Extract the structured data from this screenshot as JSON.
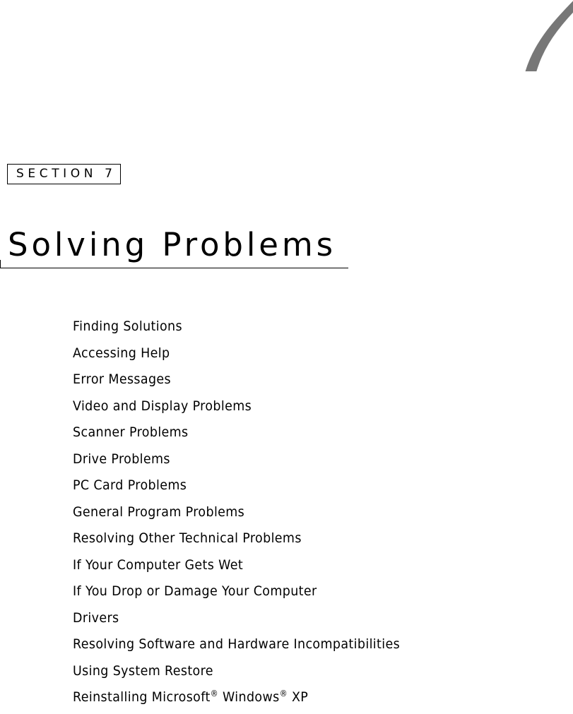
{
  "chapter": {
    "number": "7",
    "number_color": "#777777"
  },
  "section": {
    "label": "SECTION 7"
  },
  "page_title": "Solving Problems",
  "toc": {
    "items": [
      {
        "label": "Finding Solutions"
      },
      {
        "label": "Accessing Help"
      },
      {
        "label": "Error Messages"
      },
      {
        "label": "Video and Display Problems"
      },
      {
        "label": "Scanner Problems"
      },
      {
        "label": "Drive Problems"
      },
      {
        "label": "PC Card Problems"
      },
      {
        "label": "General Program Problems"
      },
      {
        "label": "Resolving Other Technical Problems"
      },
      {
        "label": "If Your Computer Gets Wet"
      },
      {
        "label": "If You Drop or Damage Your Computer"
      },
      {
        "label": "Drivers"
      },
      {
        "label": "Resolving Software and Hardware Incompatibilities"
      },
      {
        "label": "Using System Restore"
      },
      {
        "label": "Reinstalling Microsoft® Windows® XP",
        "parts": [
          "Reinstalling Microsoft",
          "®",
          " Windows",
          "®",
          " XP"
        ]
      }
    ]
  }
}
